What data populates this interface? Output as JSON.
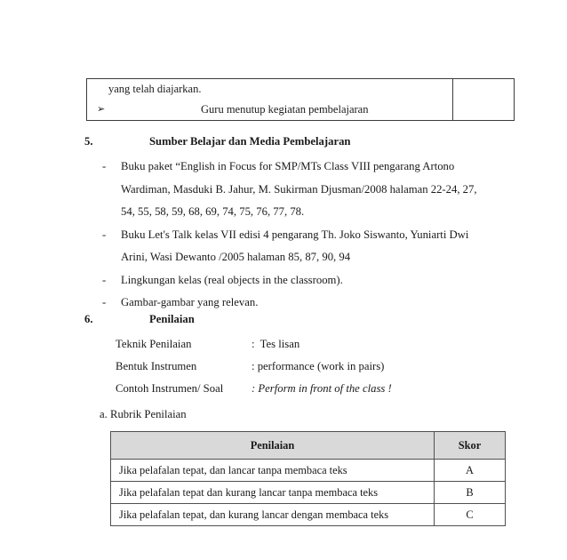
{
  "document": {
    "top_table": {
      "line_1": "yang telah diajarkan.",
      "bullet_glyph": "➢",
      "line_2": "Guru menutup kegiatan pembelajaran",
      "side_cell_1": "",
      "side_cell_2": ""
    },
    "section_5": {
      "number": "5.",
      "title": "Sumber Belajar dan Media Pembelajaran",
      "marker": "-",
      "items": [
        {
          "lines": [
            "Buku paket “English in Focus for SMP/MTs Class VIII pengarang Artono",
            "Wardiman, Masduki B. Jahur, M. Sukirman Djusman/2008 halaman 22-24, 27,",
            "54, 55, 58, 59, 68, 69, 74, 75, 76, 77, 78."
          ]
        },
        {
          "lines": [
            "Buku Let's Talk  kelas VII edisi 4 pengarang Th. Joko Siswanto, Yuniarti Dwi",
            "Arini, Wasi Dewanto /2005 halaman 85, 87, 90, 94"
          ]
        },
        {
          "lines": [
            "Lingkungan kelas (real objects in the classroom)."
          ]
        },
        {
          "lines": [
            "Gambar-gambar yang relevan."
          ]
        }
      ]
    },
    "section_6": {
      "number": "6.",
      "title": "Penilaian",
      "rows": [
        {
          "label": "Teknik Penilaian",
          "value": ":  Tes lisan",
          "italic": false
        },
        {
          "label": "Bentuk Instrumen",
          "value": ": performance (work in pairs)",
          "italic": false
        },
        {
          "label": "Contoh Instrumen/ Soal",
          "value": ": Perform in front of the class !",
          "italic": true
        }
      ]
    },
    "rubric": {
      "caption": "a. Rubrik Penilaian",
      "headers": {
        "description": "Penilaian",
        "score": "Skor"
      },
      "rows": [
        {
          "description": "Jika pelafalan tepat, dan  lancar tanpa membaca teks",
          "score": "A"
        },
        {
          "description": "Jika pelafalan tepat dan kurang lancar tanpa membaca teks",
          "score": "B"
        },
        {
          "description": "Jika pelafalan tepat, dan kurang lancar dengan membaca teks",
          "score": "C"
        }
      ]
    }
  }
}
